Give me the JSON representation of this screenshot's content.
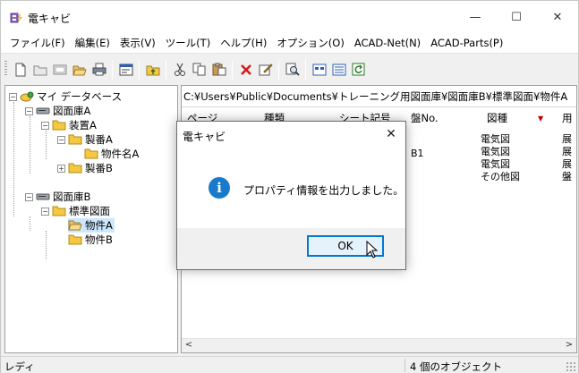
{
  "window": {
    "title": "電キャビ",
    "controls": {
      "minimize": "—",
      "maximize": "☐",
      "close": "✕"
    }
  },
  "menu": [
    "ファイル(F)",
    "編集(E)",
    "表示(V)",
    "ツール(T)",
    "ヘルプ(H)",
    "オプション(O)",
    "ACAD-Net(N)",
    "ACAD-Parts(P)"
  ],
  "toolbar": {
    "icons": [
      "new-document-icon",
      "new-folder-icon",
      "print-preview-icon",
      "open-icon",
      "print-icon",
      "properties-icon",
      "folder-up-icon",
      "cut-icon",
      "copy-icon",
      "paste-icon",
      "delete-icon",
      "edit-icon",
      "search-icon",
      "large-icons-view-icon",
      "details-view-icon",
      "refresh-icon"
    ]
  },
  "tree": {
    "items": [
      {
        "label": "マイ データベース",
        "icon": "database-icon",
        "level": 0,
        "expanded": true
      },
      {
        "label": "図面庫A",
        "icon": "drive-icon",
        "level": 1,
        "expanded": true
      },
      {
        "label": "装置A",
        "icon": "folder-icon",
        "level": 2,
        "expanded": true
      },
      {
        "label": "製番A",
        "icon": "folder-icon",
        "level": 3,
        "expanded": true
      },
      {
        "label": "物件名A",
        "icon": "folder-icon",
        "level": 4,
        "expanded": null
      },
      {
        "label": "製番B",
        "icon": "folder-icon",
        "level": 3,
        "expanded": false
      },
      {
        "label": "図面庫B",
        "icon": "drive-icon",
        "level": 1,
        "expanded": true
      },
      {
        "label": "標準図面",
        "icon": "folder-icon",
        "level": 2,
        "expanded": true
      },
      {
        "label": "物件A",
        "icon": "open-folder-icon",
        "level": 3,
        "expanded": null,
        "selected": true
      },
      {
        "label": "物件B",
        "icon": "folder-icon",
        "level": 3,
        "expanded": null
      }
    ]
  },
  "list": {
    "path": "C:¥Users¥Public¥Documents¥トレーニング用図面庫¥図面庫B¥標準図面¥物件A",
    "columns": [
      "ページ",
      "種類",
      "シート記号",
      "盤No.",
      "図種",
      "用"
    ],
    "rows": [
      {
        "panel": "",
        "type": "電気図",
        "use": "展"
      },
      {
        "panel": "",
        "type": "電気図",
        "use": "展"
      },
      {
        "panel": "B1",
        "type": "電気図",
        "use": "展"
      },
      {
        "panel": "",
        "type": "その他図",
        "use": "盤"
      }
    ],
    "sort_indicator": "▼"
  },
  "status": {
    "left": "レディ",
    "right": "4 個のオブジェクト"
  },
  "dialog": {
    "title": "電キャビ",
    "close": "✕",
    "icon_text": "i",
    "message": "プロパティ情報を出力しました。",
    "ok": "OK"
  },
  "scroll": {
    "left": "<",
    "right": ">"
  },
  "colors": {
    "accent": "#0078d7",
    "info_icon": "#1979ca",
    "sort_arrow": "#c00000",
    "folder": "#f5c842",
    "selection": "#cce8ff"
  }
}
